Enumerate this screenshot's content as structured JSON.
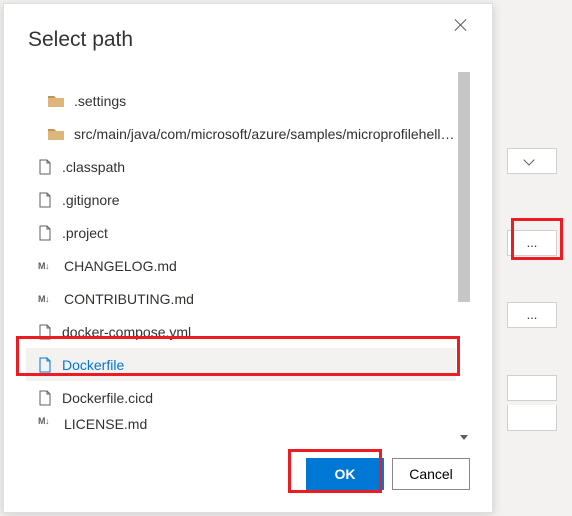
{
  "modal": {
    "title": "Select path",
    "buttons": {
      "ok": "OK",
      "cancel": "Cancel"
    }
  },
  "items": [
    {
      "type": "folder",
      "name": ".settings"
    },
    {
      "type": "folder",
      "name": "src/main/java/com/microsoft/azure/samples/microprofilehelloa..."
    },
    {
      "type": "file",
      "name": ".classpath"
    },
    {
      "type": "file",
      "name": ".gitignore"
    },
    {
      "type": "file",
      "name": ".project"
    },
    {
      "type": "md",
      "name": "CHANGELOG.md"
    },
    {
      "type": "md",
      "name": "CONTRIBUTING.md"
    },
    {
      "type": "file",
      "name": "docker-compose.yml"
    },
    {
      "type": "file",
      "name": "Dockerfile",
      "selected": true
    },
    {
      "type": "file",
      "name": "Dockerfile.cicd"
    },
    {
      "type": "md",
      "name": "LICENSE.md",
      "cut": true
    }
  ],
  "bg": {
    "ellipsis": "..."
  }
}
